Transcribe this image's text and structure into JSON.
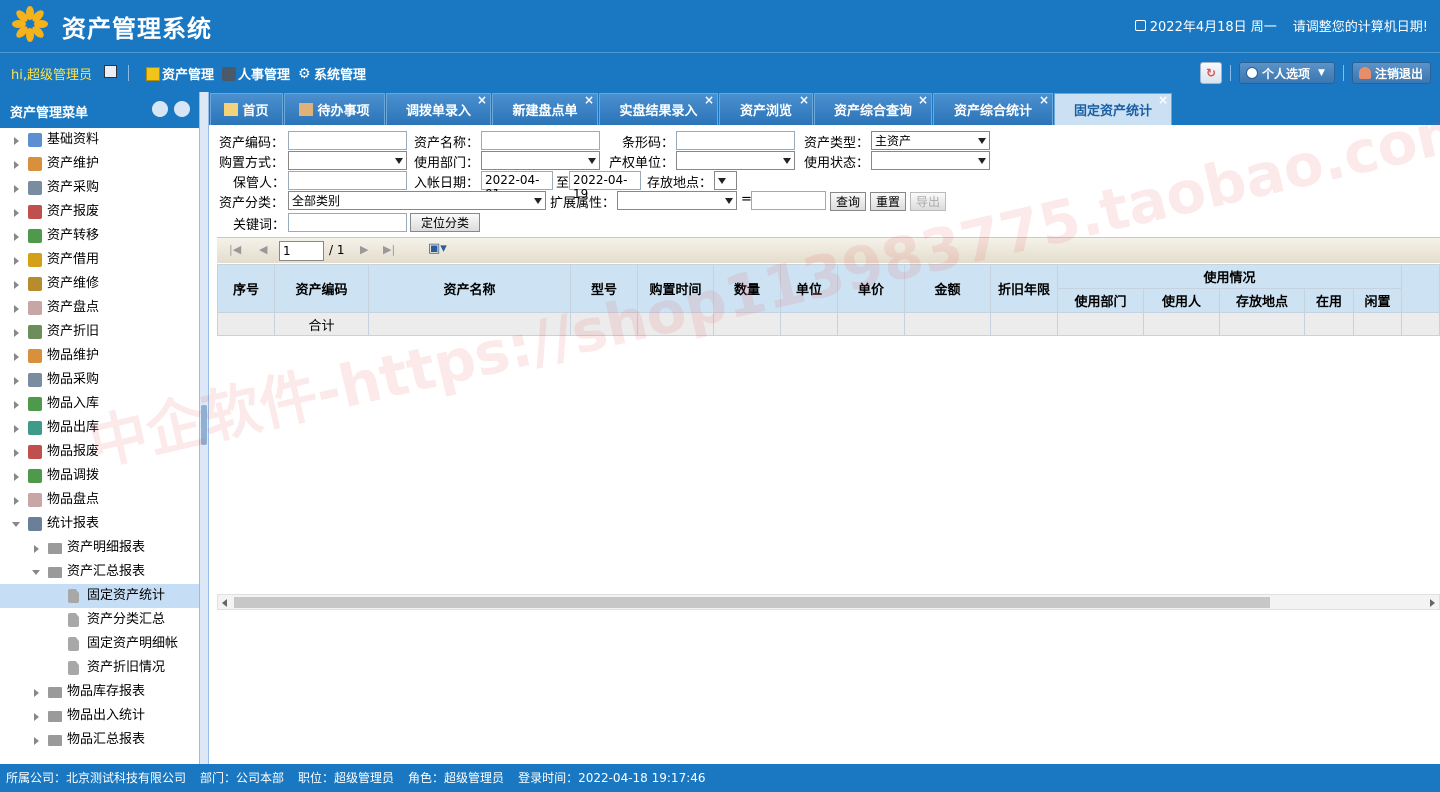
{
  "header": {
    "title": "资产管理系统",
    "date": "2022年4月18日 周一",
    "notice": "请调整您的计算机日期!"
  },
  "toolbar": {
    "greeting": "hi,超级管理员",
    "modules": [
      "资产管理",
      "人事管理",
      "系统管理"
    ],
    "profile_label": "个人选项",
    "logout_label": "注销退出"
  },
  "sidebar": {
    "title": "资产管理菜单",
    "items": [
      {
        "label": "基础资料",
        "icon": "book-icon"
      },
      {
        "label": "资产维护",
        "icon": "box-icon"
      },
      {
        "label": "资产采购",
        "icon": "cart-icon"
      },
      {
        "label": "资产报废",
        "icon": "cart-delete-icon"
      },
      {
        "label": "资产转移",
        "icon": "transfer-icon"
      },
      {
        "label": "资产借用",
        "icon": "refresh-icon"
      },
      {
        "label": "资产维修",
        "icon": "repair-icon"
      },
      {
        "label": "资产盘点",
        "icon": "inventory-icon"
      },
      {
        "label": "资产折旧",
        "icon": "calculator-icon"
      },
      {
        "label": "物品维护",
        "icon": "box-icon"
      },
      {
        "label": "物品采购",
        "icon": "cart-icon"
      },
      {
        "label": "物品入库",
        "icon": "cart-add-icon"
      },
      {
        "label": "物品出库",
        "icon": "expand-icon"
      },
      {
        "label": "物品报废",
        "icon": "cart-delete-icon"
      },
      {
        "label": "物品调拨",
        "icon": "transfer-icon"
      },
      {
        "label": "物品盘点",
        "icon": "inventory-icon"
      },
      {
        "label": "统计报表",
        "icon": "chart-icon"
      },
      {
        "label": "资产明细报表",
        "icon": "folder-icon"
      },
      {
        "label": "资产汇总报表",
        "icon": "folder-open-icon"
      },
      {
        "label": "固定资产统计",
        "icon": "file-icon"
      },
      {
        "label": "资产分类汇总",
        "icon": "file-icon"
      },
      {
        "label": "固定资产明细帐",
        "icon": "file-icon"
      },
      {
        "label": "资产折旧情况",
        "icon": "file-icon"
      },
      {
        "label": "物品库存报表",
        "icon": "folder-icon"
      },
      {
        "label": "物品出入统计",
        "icon": "folder-icon"
      },
      {
        "label": "物品汇总报表",
        "icon": "folder-icon"
      }
    ]
  },
  "tabs": [
    "首页",
    "待办事项",
    "调拨单录入",
    "新建盘点单",
    "实盘结果录入",
    "资产浏览",
    "资产综合查询",
    "资产综合统计",
    "固定资产统计"
  ],
  "form": {
    "asset_code_label": "资产编码：",
    "asset_name_label": "资产名称：",
    "barcode_label": "条形码：",
    "asset_type_label": "资产类型：",
    "asset_type_value": "主资产",
    "purchase_method_label": "购置方式：",
    "dept_label": "使用部门：",
    "owner_unit_label": "产权单位：",
    "status_label": "使用状态：",
    "custodian_label": "保管人：",
    "entry_date_label": "入帐日期：",
    "date_from": "2022-04-01",
    "to_label": "至",
    "date_to": "2022-04-19",
    "location_label": "存放地点：",
    "category_label": "资产分类：",
    "category_value": "全部类别",
    "ext_attr_label": "扩展属性：",
    "equals_label": "=",
    "query_btn": "查询",
    "reset_btn": "重置",
    "export_btn": "导出",
    "keyword_label": "关键词：",
    "locate_btn": "定位分类"
  },
  "pager": {
    "page_value": "1",
    "total": "/ 1"
  },
  "grid": {
    "group_header": "使用情况",
    "columns": [
      "序号",
      "资产编码",
      "资产名称",
      "型号",
      "购置时间",
      "数量",
      "单位",
      "单价",
      "金额",
      "折旧年限",
      "使用部门",
      "使用人",
      "存放地点",
      "在用",
      "闲置"
    ],
    "total_label": "合计"
  },
  "footer": {
    "company": "所属公司：北京测试科技有限公司",
    "dept": "部门：公司本部",
    "position": "职位：超级管理员",
    "role": "角色：超级管理员",
    "login_time": "登录时间：2022-04-18 19:17:46"
  },
  "watermark": "中企软件-https://shop113983775.taobao.com",
  "colors": {
    "primary": "#1a78c2",
    "header_cell": "#cde3f4",
    "greeting": "#ffe34a"
  }
}
